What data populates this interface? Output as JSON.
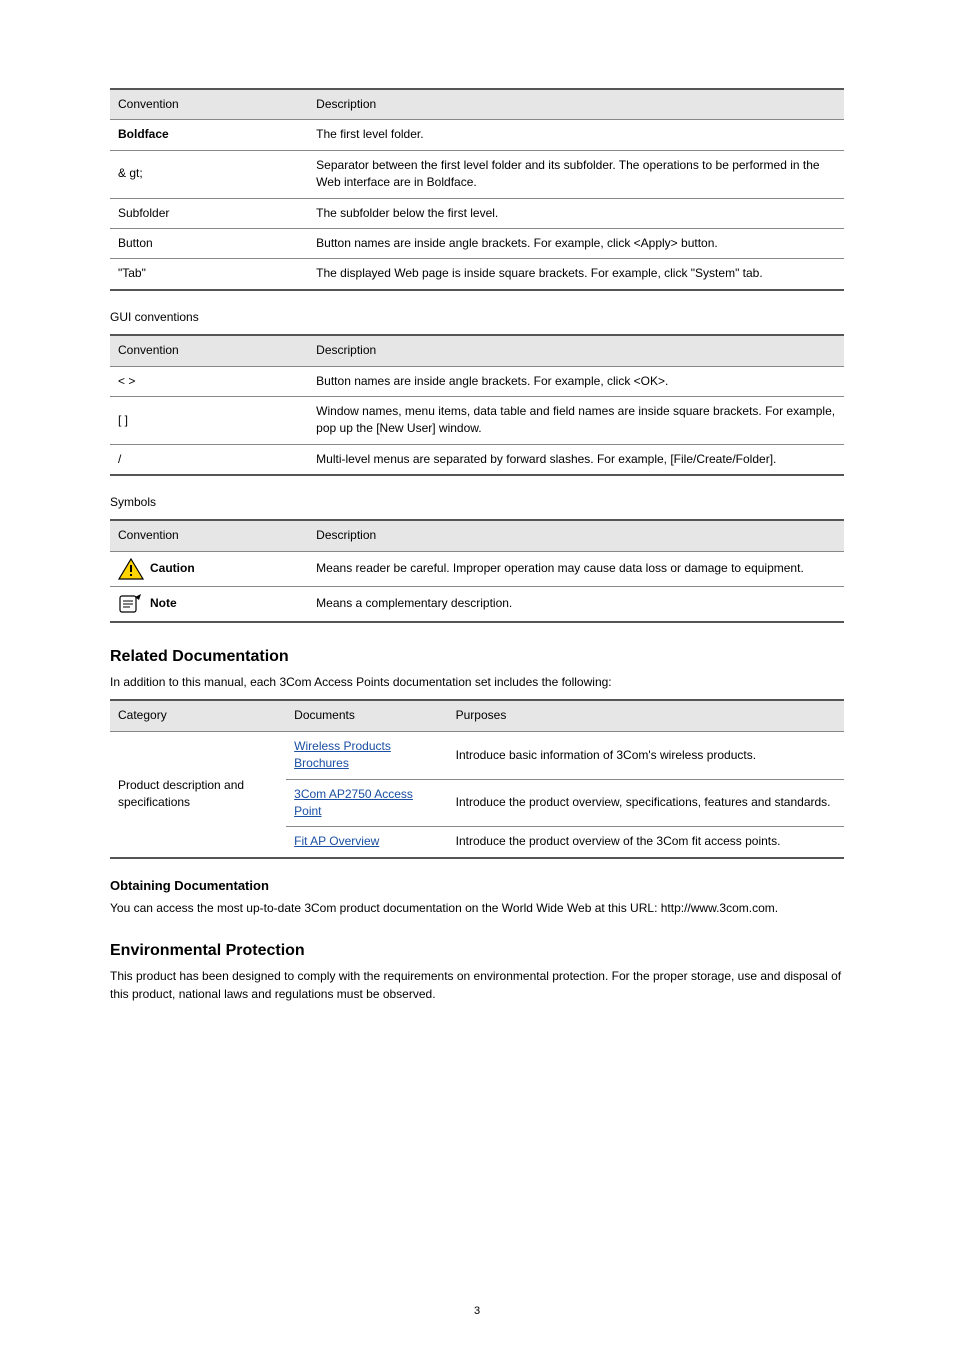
{
  "tables": {
    "conventions": {
      "headers": [
        "Convention",
        "Description"
      ],
      "rows": [
        [
          "Boldface",
          "The first level folder."
        ],
        [
          "& gt;",
          "Separator between the first level folder and its subfolder. The operations to be performed in the Web interface are in Boldface."
        ],
        [
          "Subfolder",
          "The subfolder below the first level."
        ],
        [
          "Button",
          "Button names are inside angle brackets. For example, click &lt;Apply&gt; button."
        ],
        [
          "\"Tab\"",
          "The displayed Web page is inside square brackets. For example, click \"System\" tab."
        ]
      ]
    },
    "gui": {
      "caption": "GUI conventions",
      "headers": [
        "Convention",
        "Description"
      ],
      "rows": [
        [
          "&lt; &gt;",
          "Button names are inside angle brackets. For example, click &lt;OK&gt;."
        ],
        [
          "[ ]",
          "Window names, menu items, data table and field names are inside square brackets. For example, pop up the [New User] window."
        ],
        [
          "/",
          "Multi-level menus are separated by forward slashes. For example, [File/Create/Folder]."
        ]
      ]
    },
    "symbols": {
      "caption": "Symbols",
      "headers": [
        "Convention",
        "Description"
      ],
      "rows": [
        [
          "Caution",
          "Means reader be careful. Improper operation may cause data loss or damage to equipment."
        ],
        [
          "Note",
          "Means a complementary description."
        ]
      ]
    },
    "related": {
      "headers": [
        "Category",
        "Documents",
        "Purposes"
      ],
      "rows": [
        {
          "category": "Product description and specifications",
          "docs": "Wireless Products Brochures",
          "purp": "Introduce basic information of 3Com's wireless products."
        },
        {
          "category": "",
          "docs": "3Com AP2750 Access Point",
          "purp": "Introduce the product overview, specifications, features and standards."
        },
        {
          "category": "",
          "docs": "Fit AP Overview",
          "purp": "Introduce the product overview of the 3Com fit access points."
        }
      ]
    }
  },
  "sections": {
    "related_h1": "Related Documentation",
    "related_para": "In addition to this manual, each 3Com Access Points documentation set includes the following:"
  },
  "sections2": {
    "obtain_h1": "Obtaining Documentation",
    "obtain_para": "You can access the most up-to-date 3Com product documentation on the World Wide Web at this URL: http://www.3com.com."
  },
  "sections3": {
    "env_h1": "Environmental Protection",
    "env_para": "This product has been designed to comply with the requirements on environmental protection. For the proper storage, use and disposal of this product, national laws and regulations must be observed."
  },
  "pagenum": "3"
}
